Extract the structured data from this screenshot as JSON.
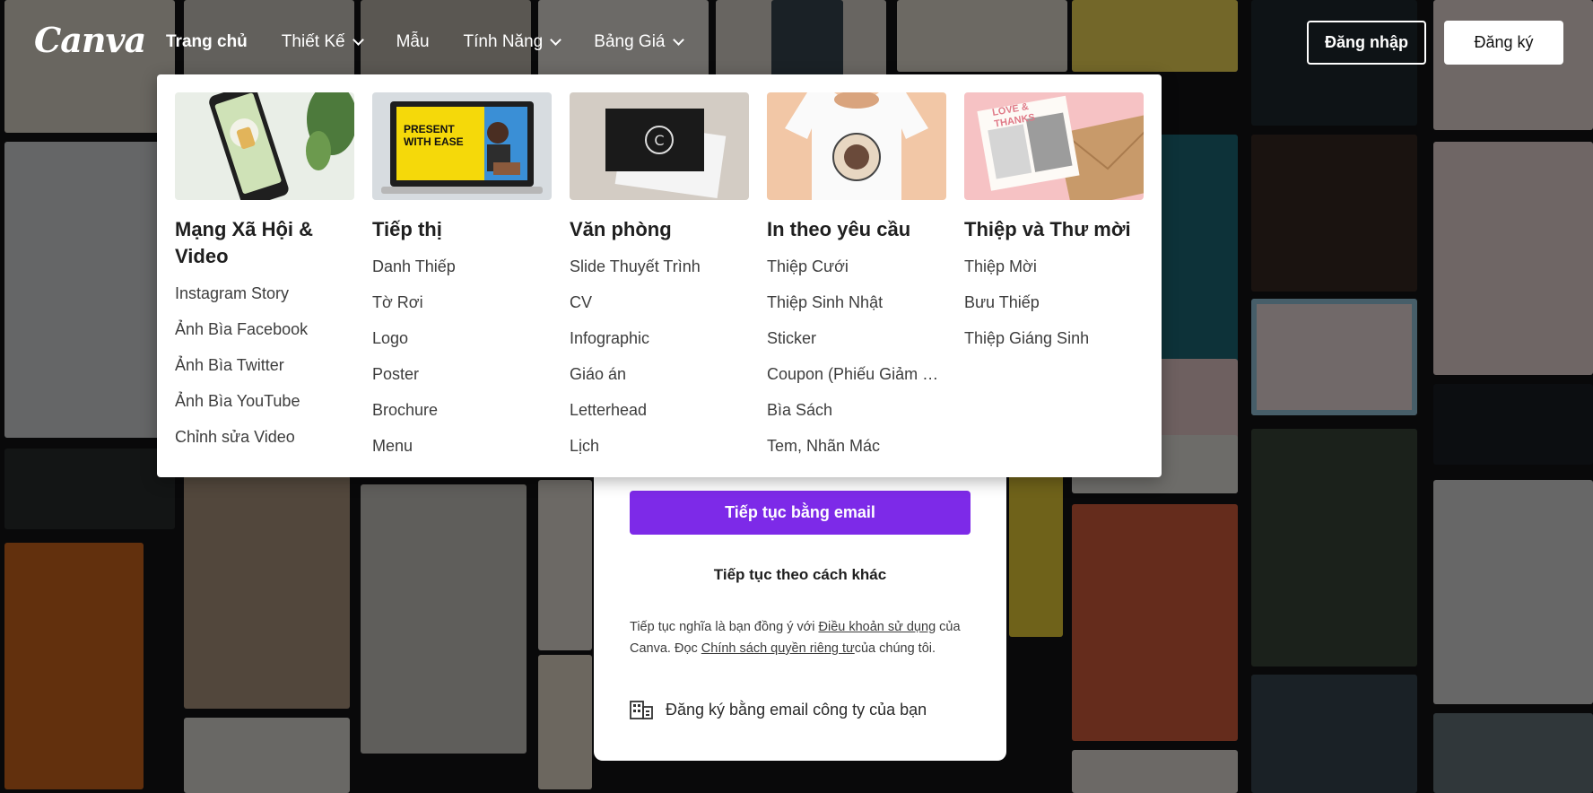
{
  "brand": {
    "logo_text": "Canva",
    "accent": "#7d2ae8"
  },
  "nav": {
    "items": [
      {
        "label": "Trang chủ",
        "active": true,
        "dropdown": false
      },
      {
        "label": "Thiết Kế",
        "active": false,
        "dropdown": true
      },
      {
        "label": "Mẫu",
        "active": false,
        "dropdown": false
      },
      {
        "label": "Tính Năng",
        "active": false,
        "dropdown": true
      },
      {
        "label": "Bảng Giá",
        "active": false,
        "dropdown": true
      }
    ],
    "login_label": "Đăng nhập",
    "signup_label": "Đăng ký"
  },
  "dropdown": {
    "columns": [
      {
        "title": "Mạng Xã Hội & Video",
        "thumb_icon": "phone-mockup",
        "items": [
          "Instagram Story",
          "Ảnh Bìa Facebook",
          "Ảnh Bìa Twitter",
          "Ảnh Bìa YouTube",
          "Chỉnh sửa Video"
        ]
      },
      {
        "title": "Tiếp thị",
        "thumb_icon": "laptop-presentation",
        "thumb_text": "PRESENT WITH EASE",
        "items": [
          "Danh Thiếp",
          "Tờ Rơi",
          "Logo",
          "Poster",
          "Brochure",
          "Menu"
        ]
      },
      {
        "title": "Văn phòng",
        "thumb_icon": "business-card",
        "items": [
          "Slide Thuyết Trình",
          "CV",
          "Infographic",
          "Giáo án",
          "Letterhead",
          "Lịch"
        ]
      },
      {
        "title": "In theo yêu cầu",
        "thumb_icon": "tshirt",
        "items": [
          "Thiệp Cưới",
          "Thiệp Sinh Nhật",
          "Sticker",
          "Coupon (Phiếu Giảm Giá)",
          "Bìa Sách",
          "Tem, Nhãn Mác"
        ]
      },
      {
        "title": "Thiệp và Thư mời",
        "thumb_icon": "greeting-card",
        "thumb_text": "LOVE & THANKS",
        "items": [
          "Thiệp Mời",
          "Bưu Thiếp",
          "Thiệp Giáng Sinh"
        ]
      }
    ]
  },
  "signup_card": {
    "email_button": "Tiếp tục bằng email",
    "other_way": "Tiếp tục theo cách khác",
    "terms_prefix": "Tiếp tục nghĩa là bạn đồng ý với ",
    "terms_link": "Điều khoản sử dụng",
    "terms_mid": " của Canva. Đọc ",
    "privacy_link": "Chính sách quyền riêng tư",
    "terms_suffix": "của chúng tôi.",
    "business_signup": "Đăng ký bằng email công ty của bạn"
  }
}
